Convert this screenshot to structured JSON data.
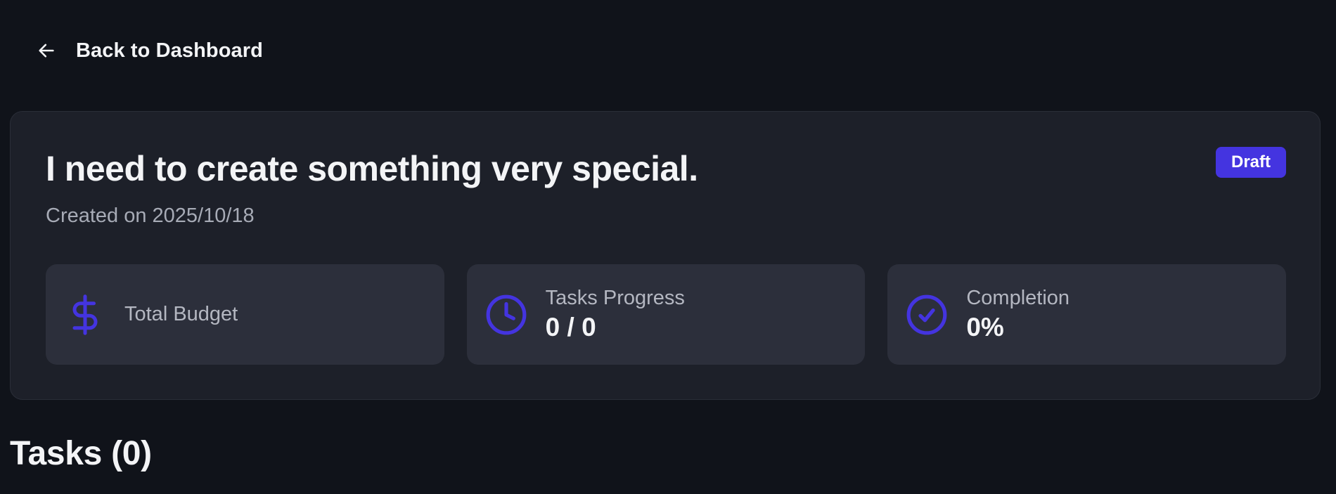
{
  "nav": {
    "back_label": "Back to Dashboard",
    "back_icon": "arrow-left-icon"
  },
  "project": {
    "title": "I need to create something very special.",
    "created_on": "Created on 2025/10/18",
    "status": "Draft"
  },
  "stats": [
    {
      "icon": "dollar-icon",
      "label": "Total Budget",
      "value": ""
    },
    {
      "icon": "clock-icon",
      "label": "Tasks Progress",
      "value": "0 / 0"
    },
    {
      "icon": "check-circle-icon",
      "label": "Completion",
      "value": "0%"
    }
  ],
  "tasks": {
    "heading": "Tasks (0)"
  },
  "colors": {
    "background": "#10131a",
    "card": "#1d2029",
    "stat_card": "#2c2f3b",
    "accent": "#4434e0",
    "text": "#f3f4f6",
    "muted_text": "#a7abb6"
  }
}
